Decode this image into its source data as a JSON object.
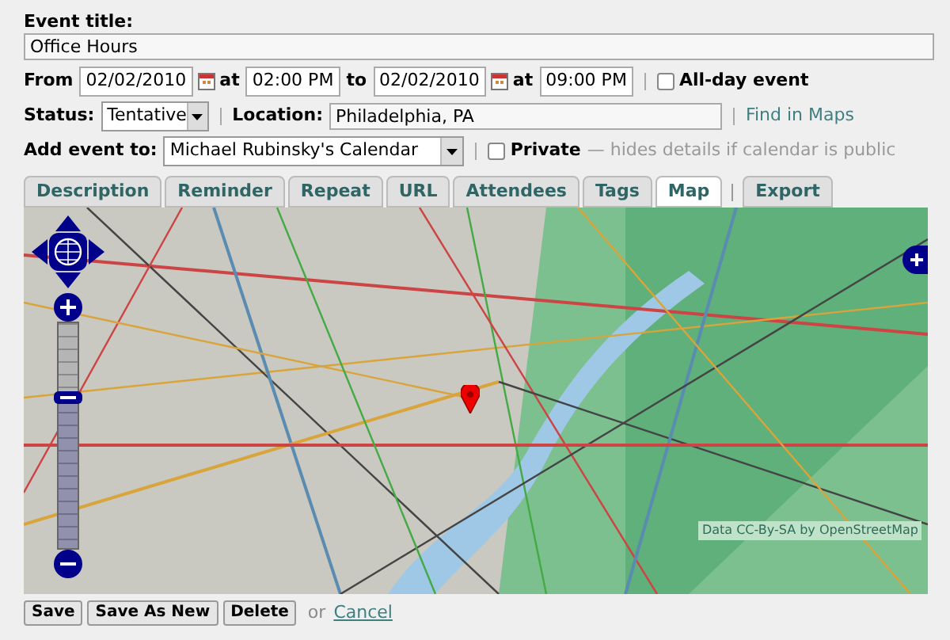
{
  "event_title": {
    "label": "Event title:",
    "value": "Office Hours"
  },
  "time": {
    "from_label": "From",
    "start_date": "02/02/2010",
    "at_label_1": "at",
    "start_time": "02:00 PM",
    "to_label": "to",
    "end_date": "02/02/2010",
    "at_label_2": "at",
    "end_time": "09:00 PM",
    "all_day": {
      "label": "All-day event",
      "checked": false
    }
  },
  "status": {
    "label": "Status:",
    "value": "Tentative"
  },
  "location": {
    "label": "Location:",
    "value": "Philadelphia, PA",
    "link": "Find in Maps"
  },
  "calendar": {
    "label": "Add event to:",
    "value": "Michael Rubinsky's Calendar"
  },
  "private": {
    "label": "Private",
    "checked": false,
    "hint": "— hides details if calendar is public"
  },
  "tabs": [
    {
      "label": "Description",
      "selected": false,
      "divider_before": false
    },
    {
      "label": "Reminder",
      "selected": false,
      "divider_before": false
    },
    {
      "label": "Repeat",
      "selected": false,
      "divider_before": false
    },
    {
      "label": "URL",
      "selected": false,
      "divider_before": false
    },
    {
      "label": "Attendees",
      "selected": false,
      "divider_before": false
    },
    {
      "label": "Tags",
      "selected": false,
      "divider_before": false
    },
    {
      "label": "Map",
      "selected": true,
      "divider_before": false
    },
    {
      "label": "Export",
      "selected": false,
      "divider_before": true
    }
  ],
  "map": {
    "attribution": "Data CC-By-SA by OpenStreetMap",
    "zoom": {
      "level": 0.67
    }
  },
  "buttons": [
    "Save",
    "Save As New",
    "Delete"
  ],
  "or_text": "or",
  "cancel_link": "Cancel"
}
